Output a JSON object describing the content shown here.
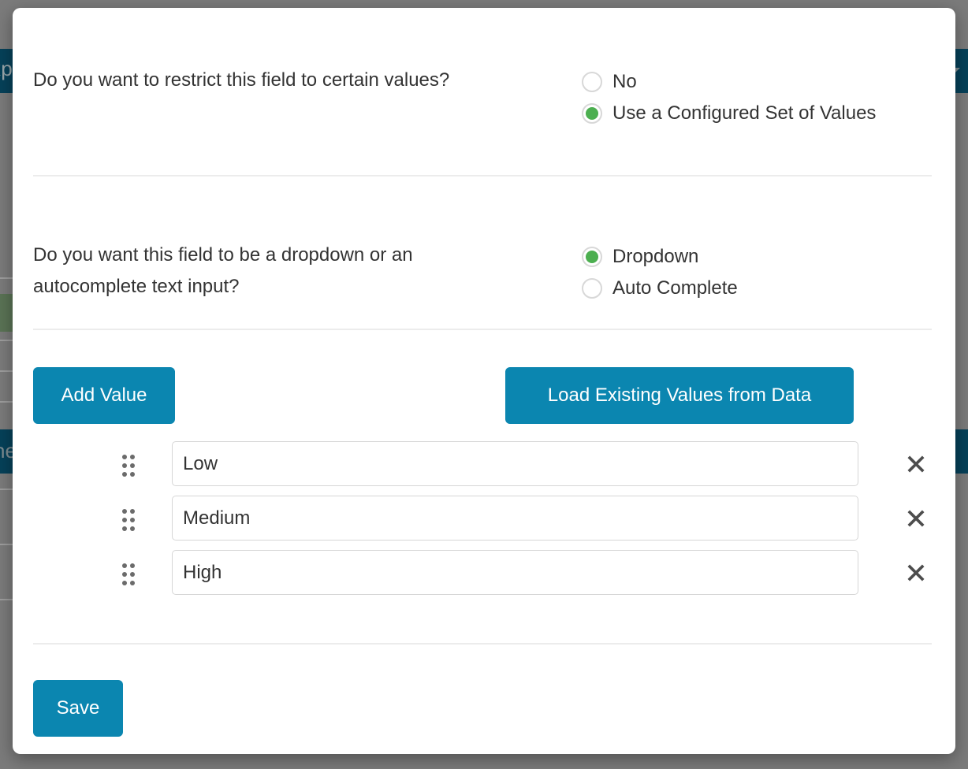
{
  "background": {
    "navbar_top_text": "xp",
    "navbar_bottom_text": "ne",
    "caret_icon": "chevron-down-icon",
    "navbar_color": "#064159",
    "accent_green": "#5a7355",
    "overlay_color": "#7b7b7b"
  },
  "modal": {
    "accent_blue": "#0b86b0",
    "radio_selected_color": "#4caf50",
    "questions": [
      {
        "label": "Do you want to restrict this field to certain values?",
        "options": [
          {
            "label": "No",
            "selected": false
          },
          {
            "label": "Use a Configured Set of Values",
            "selected": true
          }
        ]
      },
      {
        "label": "Do you want this field to be a dropdown or an autocomplete text input?",
        "options": [
          {
            "label": "Dropdown",
            "selected": true
          },
          {
            "label": "Auto Complete",
            "selected": false
          }
        ]
      }
    ],
    "toolbar": {
      "add_value_label": "Add Value",
      "load_values_label": "Load Existing Values from Data"
    },
    "values": [
      {
        "value": "Low",
        "placeholder": ""
      },
      {
        "value": "Medium",
        "placeholder": ""
      },
      {
        "value": "High",
        "placeholder": ""
      }
    ],
    "row_icons": {
      "drag": "drag-handle-icon",
      "remove": "remove-x-icon"
    },
    "footer": {
      "save_label": "Save"
    }
  }
}
